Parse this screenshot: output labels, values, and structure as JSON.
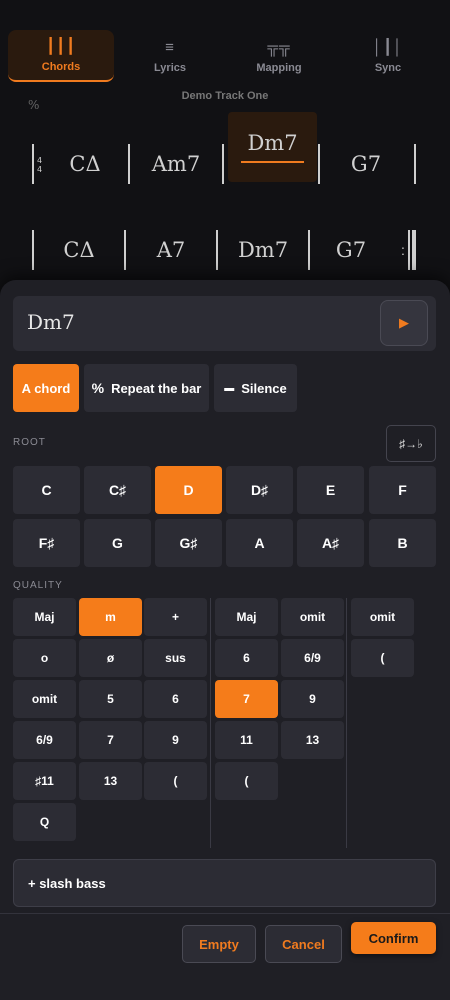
{
  "tabs": [
    {
      "label": "Chords",
      "icon": "chords-icon",
      "glyph": "┃┃┃"
    },
    {
      "label": "Lyrics",
      "icon": "lyrics-icon",
      "glyph": "≡"
    },
    {
      "label": "Mapping",
      "icon": "mapping-icon",
      "glyph": "╦╦"
    },
    {
      "label": "Sync",
      "icon": "sync-icon",
      "glyph": "│┃│"
    }
  ],
  "sheet": {
    "title": "Demo Track One",
    "repeat_mark": "%",
    "time_signature": [
      "4",
      "4"
    ],
    "row1": [
      "CΔ",
      "Am7",
      "Dm7",
      "G7"
    ],
    "row2": [
      "CΔ",
      "A7",
      "Dm7",
      "G7"
    ]
  },
  "editor": {
    "current_chord": "Dm7",
    "play_glyph": "▶",
    "modes": [
      "A chord",
      "Repeat the bar",
      "Silence"
    ],
    "mode_icons": [
      "",
      "%",
      "▬"
    ],
    "root_label": "ROOT",
    "accidental_toggle": "♯→♭",
    "roots": [
      "C",
      "C♯",
      "D",
      "D♯",
      "E",
      "F",
      "F♯",
      "G",
      "G♯",
      "A",
      "A♯",
      "B"
    ],
    "quality_label": "QUALITY",
    "quality_col1": [
      "Maj",
      "m",
      "+",
      "o",
      "ø",
      "sus",
      "omit",
      "5",
      "6",
      "6/9",
      "7",
      "9",
      "♯11",
      "13",
      "(",
      "Q"
    ],
    "quality_col2": [
      "Maj",
      "omit",
      "6",
      "6/9",
      "7",
      "9",
      "11",
      "13",
      "("
    ],
    "quality_col3": [
      "omit",
      "("
    ],
    "slash_bass": "+ slash bass",
    "empty": "Empty",
    "cancel": "Cancel",
    "confirm": "Confirm"
  },
  "colors": {
    "accent": "#f57c1a",
    "panel": "#1f1f25",
    "button": "#2c2c34"
  }
}
